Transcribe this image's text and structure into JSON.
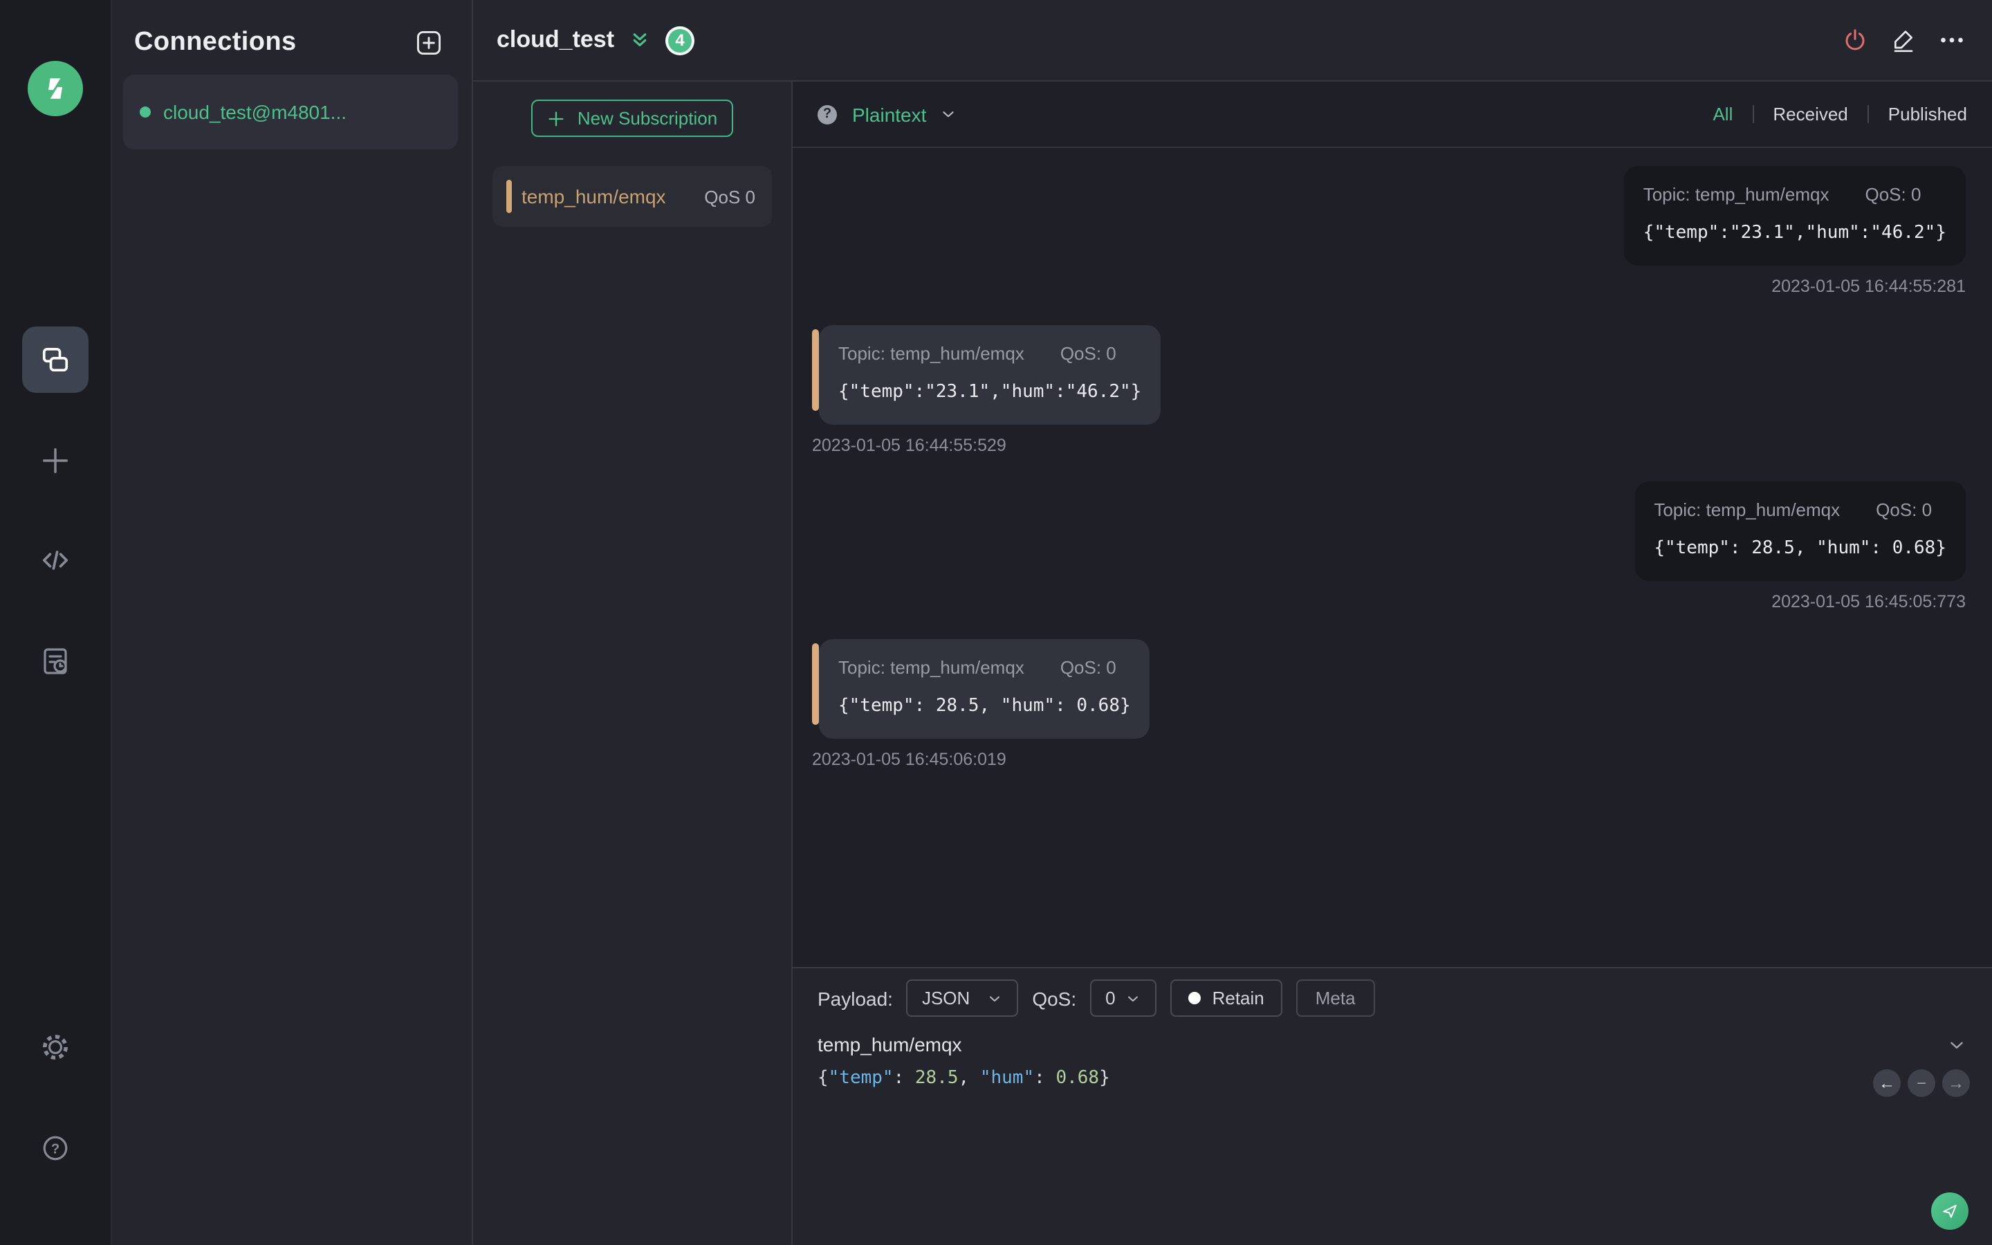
{
  "colors": {
    "accent": "#4ec08c",
    "badge_green": "#4fbe8a",
    "subscription_tan": "#d2a876",
    "message_bar_tan": "#d9ad7f",
    "disconnect_red": "#e06c6c"
  },
  "sidebar": {
    "icons": [
      "mqttx-logo",
      "connections",
      "new-connection",
      "script",
      "log",
      "settings",
      "help"
    ]
  },
  "connections": {
    "title": "Connections",
    "items": [
      {
        "name": "cloud_test@m4801...",
        "connected": true
      }
    ]
  },
  "header": {
    "title": "cloud_test",
    "message_count": "4"
  },
  "subscriptions": {
    "new_button": "New Subscription",
    "items": [
      {
        "topic": "temp_hum/emqx",
        "qos": "QoS 0"
      }
    ]
  },
  "messages": {
    "format_label": "Plaintext",
    "filters": [
      "All",
      "Received",
      "Published"
    ],
    "active_filter": "All",
    "items": [
      {
        "direction": "published",
        "topic_label": "Topic: temp_hum/emqx",
        "qos_label": "QoS: 0",
        "payload": "{\"temp\":\"23.1\",\"hum\":\"46.2\"}",
        "timestamp": "2023-01-05 16:44:55:281"
      },
      {
        "direction": "received",
        "topic_label": "Topic: temp_hum/emqx",
        "qos_label": "QoS: 0",
        "payload": "{\"temp\":\"23.1\",\"hum\":\"46.2\"}",
        "timestamp": "2023-01-05 16:44:55:529"
      },
      {
        "direction": "published",
        "topic_label": "Topic: temp_hum/emqx",
        "qos_label": "QoS: 0",
        "payload": "{\"temp\": 28.5, \"hum\": 0.68}",
        "timestamp": "2023-01-05 16:45:05:773"
      },
      {
        "direction": "received",
        "topic_label": "Topic: temp_hum/emqx",
        "qos_label": "QoS: 0",
        "payload": "{\"temp\": 28.5, \"hum\": 0.68}",
        "timestamp": "2023-01-05 16:45:06:019"
      }
    ]
  },
  "publish": {
    "payload_label": "Payload:",
    "payload_format": "JSON",
    "qos_label": "QoS:",
    "qos_value": "0",
    "retain_label": "Retain",
    "meta_label": "Meta",
    "topic_value": "temp_hum/emqx",
    "history_icons": [
      "←",
      "−",
      "→"
    ],
    "payload_tokens": [
      {
        "text": "{",
        "type": "punct"
      },
      {
        "text": "\"temp\"",
        "type": "key"
      },
      {
        "text": ": ",
        "type": "punct"
      },
      {
        "text": "28.5",
        "type": "number"
      },
      {
        "text": ", ",
        "type": "punct"
      },
      {
        "text": "\"hum\"",
        "type": "key"
      },
      {
        "text": ": ",
        "type": "punct"
      },
      {
        "text": "0.68",
        "type": "number"
      },
      {
        "text": "}",
        "type": "punct"
      }
    ]
  }
}
